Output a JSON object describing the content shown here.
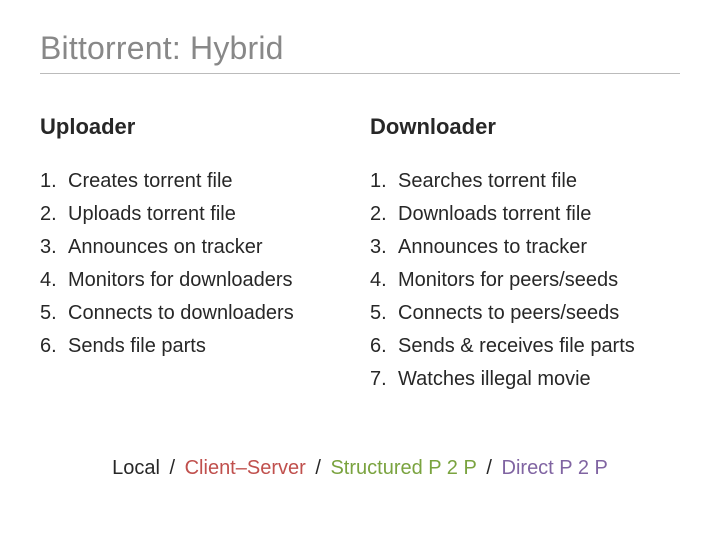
{
  "title": "Bittorrent: Hybrid",
  "left": {
    "heading": "Uploader",
    "items": [
      "Creates torrent file",
      "Uploads torrent file",
      "Announces on tracker",
      "Monitors for downloaders",
      "Connects to downloaders",
      "Sends file parts"
    ]
  },
  "right": {
    "heading": "Downloader",
    "items": [
      "Searches torrent file",
      "Downloads torrent file",
      "Announces to tracker",
      "Monitors for peers/seeds",
      "Connects to peers/seeds",
      "Sends & receives file parts",
      "Watches illegal movie"
    ]
  },
  "footer": {
    "parts": [
      {
        "text": "Local",
        "color": ""
      },
      {
        "text": "Client–Server",
        "color": "accent-red"
      },
      {
        "text": "Structured P 2 P",
        "color": "accent-green"
      },
      {
        "text": "Direct P 2 P",
        "color": "accent-purple"
      }
    ],
    "separator": " / "
  }
}
